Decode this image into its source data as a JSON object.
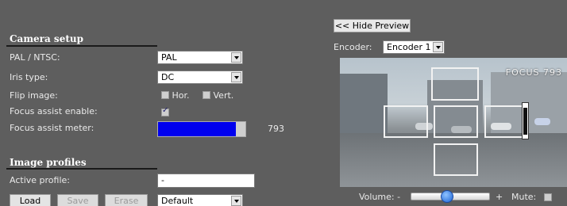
{
  "camera_setup": {
    "title": "Camera setup",
    "pal_ntsc": {
      "label": "PAL / NTSC:",
      "value": "PAL"
    },
    "iris_type": {
      "label": "Iris type:",
      "value": "DC"
    },
    "flip_image": {
      "label": "Flip image:",
      "hor_label": "Hor.",
      "vert_label": "Vert.",
      "hor_checked": false,
      "vert_checked": false
    },
    "focus_assist_enable": {
      "label": "Focus assist enable:",
      "checked": true
    },
    "focus_assist_meter": {
      "label": "Focus assist meter:",
      "value": "793",
      "fill_fraction": 0.89,
      "fill_color": "#0000ee"
    }
  },
  "image_profiles": {
    "title": "Image profiles",
    "active_profile": {
      "label": "Active profile:",
      "value": "-"
    },
    "buttons": {
      "load": "Load",
      "save": "Save",
      "erase": "Erase"
    },
    "profile_select": "Default"
  },
  "preview": {
    "hide_preview_button": "<< Hide Preview",
    "encoder_label": "Encoder:",
    "encoder_value": "Encoder 1",
    "osd_text": "FOCUS 793",
    "volume_label": "Volume: -",
    "volume_plus": "+",
    "volume_level": 0.45,
    "mute_label": "Mute:",
    "mute_checked": false
  }
}
